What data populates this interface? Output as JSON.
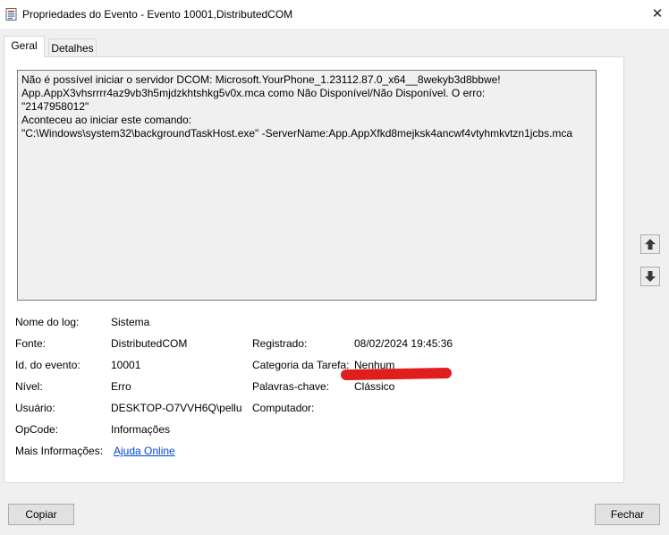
{
  "window": {
    "title": "Propriedades do Evento - Evento 10001,DistributedCOM",
    "close_glyph": "✕"
  },
  "tabs": [
    {
      "label": "Geral"
    },
    {
      "label": "Detalhes"
    }
  ],
  "description": {
    "lines": [
      "Não é possível iniciar o servidor DCOM: Microsoft.YourPhone_1.23112.87.0_x64__8wekyb3d8bbwe!",
      "App.AppX3vhsrrrr4az9vb3h5mjdzkhtshkg5v0x.mca como Não Disponível/Não Disponível. O erro:",
      "\"2147958012\"",
      "Aconteceu ao iniciar este comando:",
      "\"C:\\Windows\\system32\\backgroundTaskHost.exe\" -ServerName:App.AppXfkd8mejksk4ancwf4vtyhmkvtzn1jcbs.mca"
    ]
  },
  "fields": {
    "log_name_label": "Nome do log:",
    "log_name_value": "Sistema",
    "source_label": "Fonte:",
    "source_value": "DistributedCOM",
    "logged_label": "Registrado:",
    "logged_value": "08/02/2024 19:45:36",
    "event_id_label": "Id. do evento:",
    "event_id_value": "10001",
    "task_category_label": "Categoria da Tarefa:",
    "task_category_value": "Nenhum",
    "level_label": "Nível:",
    "level_value": "Erro",
    "keywords_label": "Palavras-chave:",
    "keywords_value": "Clássico",
    "user_label": "Usuário:",
    "user_value": "DESKTOP-O7VVH6Q\\pellu",
    "computer_label": "Computador:",
    "opcode_label": "OpCode:",
    "opcode_value": "Informações",
    "more_info_label": "Mais Informações:",
    "more_info_link": "Ajuda Online"
  },
  "buttons": {
    "copy": "Copiar",
    "close": "Fechar"
  },
  "colors": {
    "link": "#0044cc",
    "redaction": "#e01e1e"
  }
}
